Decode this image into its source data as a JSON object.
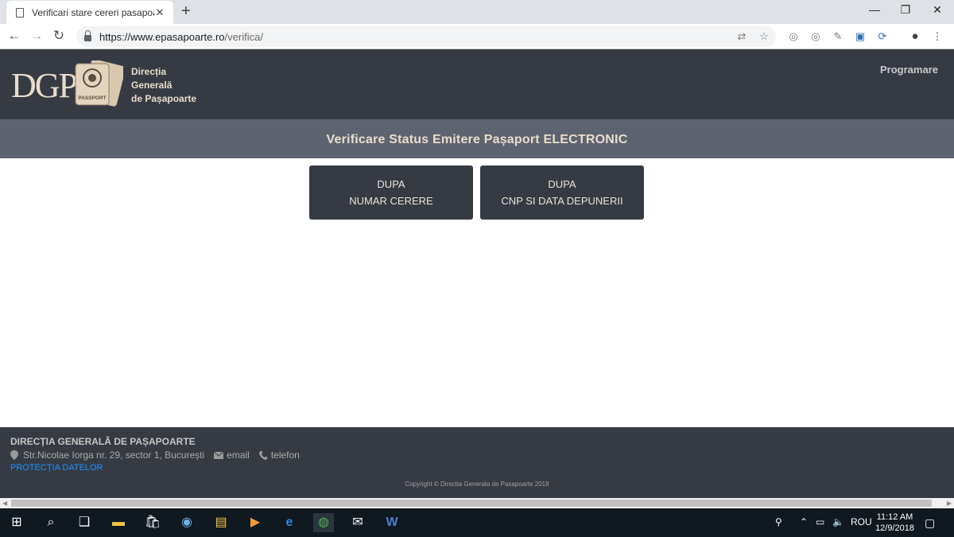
{
  "browser": {
    "tab_title": "Verificari stare cereri pasapoarte",
    "tab_close": "✕",
    "new_tab": "+",
    "url_host": "https://www.epasapoarte.ro",
    "url_path": "/verifica/",
    "minimize": "—",
    "restore": "❐",
    "close": "✕"
  },
  "header": {
    "logo_text": "DGP",
    "logo_line1": "Direcția",
    "logo_line2": "Generală",
    "logo_line3": "de Pașapoarte",
    "badge_text": "PASSPORT",
    "nav_programare": "Programare"
  },
  "subheader": {
    "title": "Verificare Status Emitere Pașaport ELECTRONIC"
  },
  "choices": [
    {
      "line1": "DUPA",
      "line2": "NUMAR CERERE"
    },
    {
      "line1": "DUPA",
      "line2": "CNP SI DATA DEPUNERII"
    }
  ],
  "footer": {
    "name": "DIRECȚIA GENERALĂ DE PAȘAPOARTE",
    "address": "Str.Nicolae Iorga nr. 29, sector 1, București",
    "email": "email",
    "telefon": "telefon",
    "privacy": "PROTECȚIA DATELOR",
    "copyright": "Copyright © Directia Generala de Pasapoarte 2018"
  },
  "taskbar": {
    "language": "ROU",
    "time": "11:12 AM",
    "date": "12/9/2018"
  },
  "colors": {
    "header_bg": "#363b43",
    "subheader_bg": "#5d6470",
    "accent_text": "#eadccc",
    "link_blue": "#1e90ff"
  }
}
